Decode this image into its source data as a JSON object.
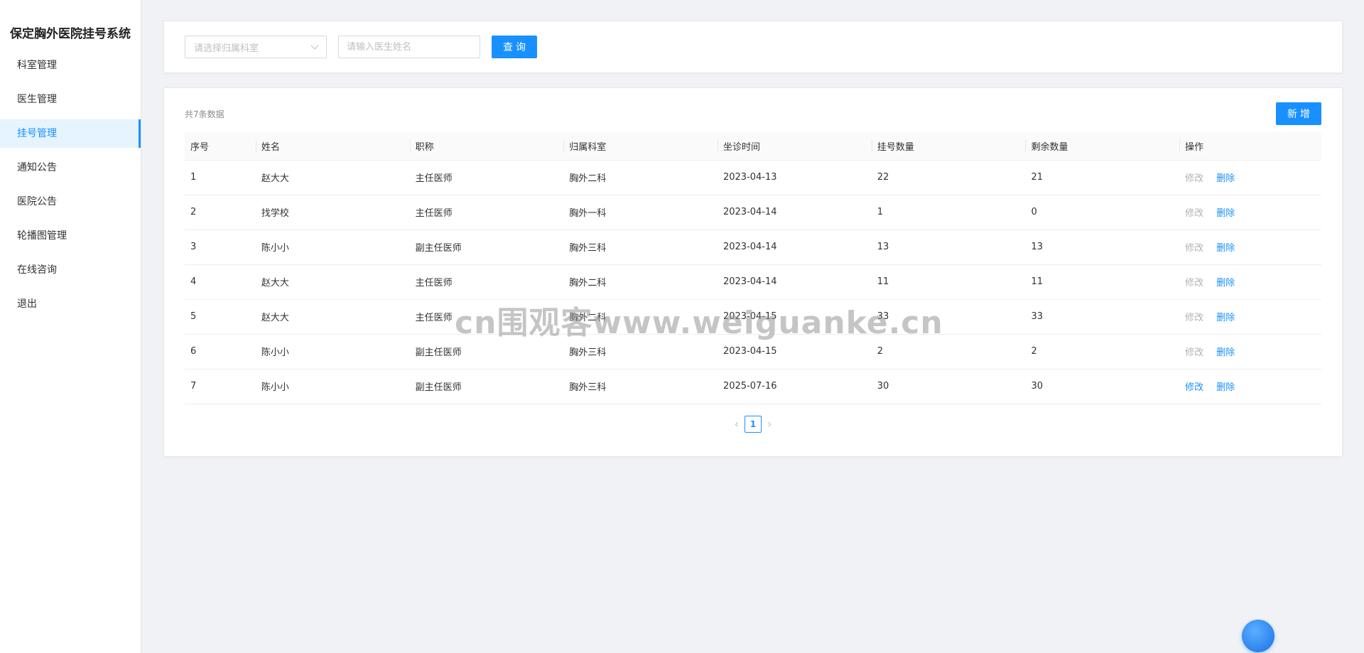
{
  "app": {
    "title": "保定胸外医院挂号系统"
  },
  "sidebar": {
    "items": [
      {
        "label": "科室管理"
      },
      {
        "label": "医生管理"
      },
      {
        "label": "挂号管理"
      },
      {
        "label": "通知公告"
      },
      {
        "label": "医院公告"
      },
      {
        "label": "轮播图管理"
      },
      {
        "label": "在线咨询"
      },
      {
        "label": "退出"
      }
    ],
    "active_index": 2
  },
  "search": {
    "department_placeholder": "请选择归属科室",
    "doctor_placeholder": "请输入医生姓名",
    "doctor_value": "",
    "query_label": "查询"
  },
  "table": {
    "count_text": "共7条数据",
    "add_label": "新增",
    "columns": [
      "序号",
      "姓名",
      "职称",
      "归属科室",
      "坐诊时间",
      "挂号数量",
      "剩余数量",
      "操作"
    ],
    "edit_label": "修改",
    "delete_label": "删除",
    "rows": [
      {
        "no": "1",
        "name": "赵大大",
        "title": "主任医师",
        "dept": "胸外二科",
        "date": "2023-04-13",
        "total": "22",
        "remaining": "21",
        "edit_enabled": false
      },
      {
        "no": "2",
        "name": "找学校",
        "title": "主任医师",
        "dept": "胸外一科",
        "date": "2023-04-14",
        "total": "1",
        "remaining": "0",
        "edit_enabled": false
      },
      {
        "no": "3",
        "name": "陈小小",
        "title": "副主任医师",
        "dept": "胸外三科",
        "date": "2023-04-14",
        "total": "13",
        "remaining": "13",
        "edit_enabled": false
      },
      {
        "no": "4",
        "name": "赵大大",
        "title": "主任医师",
        "dept": "胸外二科",
        "date": "2023-04-14",
        "total": "11",
        "remaining": "11",
        "edit_enabled": false
      },
      {
        "no": "5",
        "name": "赵大大",
        "title": "主任医师",
        "dept": "胸外二科",
        "date": "2023-04-15",
        "total": "33",
        "remaining": "33",
        "edit_enabled": false
      },
      {
        "no": "6",
        "name": "陈小小",
        "title": "副主任医师",
        "dept": "胸外三科",
        "date": "2023-04-15",
        "total": "2",
        "remaining": "2",
        "edit_enabled": false
      },
      {
        "no": "7",
        "name": "陈小小",
        "title": "副主任医师",
        "dept": "胸外三科",
        "date": "2025-07-16",
        "total": "30",
        "remaining": "30",
        "edit_enabled": true
      }
    ]
  },
  "pagination": {
    "current_page": "1",
    "prev_icon": "chevron-left-icon",
    "next_icon": "chevron-right-icon"
  },
  "watermark": {
    "text": "cn围观客www.weiguanke.cn"
  },
  "colors": {
    "primary": "#1890ff",
    "disabled": "#b0b3b8",
    "background": "#f0f2f5"
  }
}
